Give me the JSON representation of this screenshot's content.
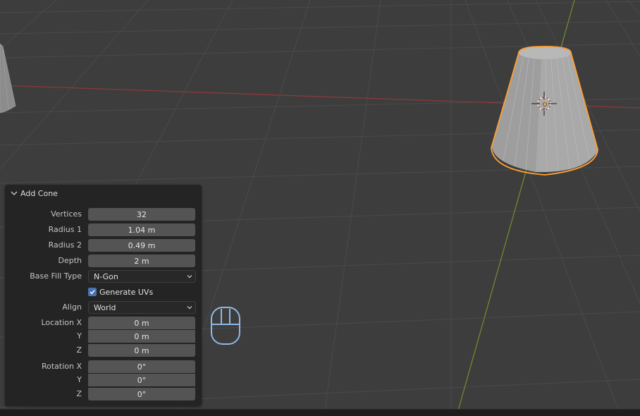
{
  "colors": {
    "background": "#3d3d3d",
    "grid_line": "#4a4a4a",
    "x_axis": "#8a3a3a",
    "y_axis": "#6e8a2e",
    "selection_outline": "#ffa033",
    "panel_bg": "#242424",
    "field_bg": "#545454",
    "accent_blue": "#4772b3"
  },
  "viewport": {
    "selected_object": "cone",
    "icons": [
      "object-origin-icon",
      "3d-cursor-icon"
    ]
  },
  "panel": {
    "title": "Add Cone",
    "vertices": {
      "label": "Vertices",
      "value": "32"
    },
    "radius1": {
      "label": "Radius 1",
      "value": "1.04 m"
    },
    "radius2": {
      "label": "Radius 2",
      "value": "0.49 m"
    },
    "depth": {
      "label": "Depth",
      "value": "2 m"
    },
    "base_fill": {
      "label": "Base Fill Type",
      "value": "N-Gon"
    },
    "generate_uvs": {
      "label": "Generate UVs",
      "checked": true
    },
    "align": {
      "label": "Align",
      "value": "World"
    },
    "location": {
      "label_x": "Location X",
      "label_y": "Y",
      "label_z": "Z",
      "x": "0 m",
      "y": "0 m",
      "z": "0 m"
    },
    "rotation": {
      "label_x": "Rotation X",
      "label_y": "Y",
      "label_z": "Z",
      "x": "0°",
      "y": "0°",
      "z": "0°"
    }
  },
  "status_icon": "mouse-icon"
}
